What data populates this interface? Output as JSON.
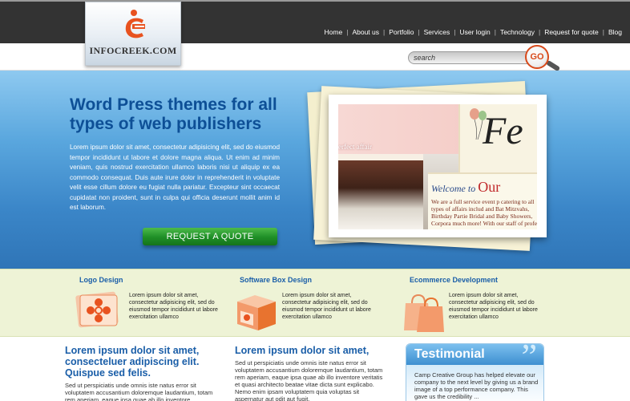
{
  "brand": {
    "name": "INFOCREEK.COM",
    "accent_color": "#e8521f"
  },
  "nav": {
    "items": [
      "Home",
      "About us",
      "Portfolio",
      "Services",
      "User login",
      "Technology",
      "Request for quote",
      "Blog"
    ]
  },
  "search": {
    "placeholder": "search",
    "button_label": "GO"
  },
  "hero": {
    "title": "Word Press themes for all types of web publishers",
    "body": "Lorem ipsum dolor sit amet, consectetur adipisicing elit, sed do eiusmod tempor incididunt ut labore et dolore magna aliqua. Ut enim ad minim veniam, quis nostrud exercitation ullamco laboris nisi ut aliquip ex ea commodo consequat. Duis aute irure dolor in reprehenderit in voluptate velit esse cillum dolore eu fugiat nulla pariatur. Excepteur sint occaecat cupidatat non proident, sunt in culpa qui officia deserunt mollit anim id est laborum.",
    "cta_label": "REQUEST A QUOTE",
    "photo": {
      "caption": "erfect affair",
      "welcome_text": "Welcome to",
      "welcome_big": "Our",
      "script_letter": "Fe",
      "paragraph": "We are a full service event p catering to all types of affairs includ and Bat Mitzvahs, Birthday Partie Bridal and Baby Showers, Corpora much more!  With our staff of profe"
    }
  },
  "services": [
    {
      "title": "Logo Design",
      "text": "Lorem ipsum dolor sit amet, consectetur adipisicing elit, sed do eiusmod tempor incididunt ut labore exercitation ullamco",
      "icon": "logo-design-icon"
    },
    {
      "title": "Software Box Design",
      "text": "Lorem ipsum dolor sit amet, consectetur adipisicing elit, sed do eiusmod tempor incididunt ut labore exercitation ullamco",
      "icon": "software-box-icon"
    },
    {
      "title": "Ecommerce Development",
      "text": "Lorem ipsum dolor sit amet, consectetur adipisicing elit, sed do eiusmod tempor incididunt ut labore exercitation ullamco",
      "icon": "shopping-bags-icon"
    }
  ],
  "content": {
    "col1_title": "Lorem ipsum dolor sit amet, consecteluer adipiscing elit. Quispue sed felis.",
    "col1_text": "Sed ut perspiciatis unde omnis iste natus error sit voluptatem accusantium doloremque laudantium, totam rem aperiam, eaque ipsa quae ab illo inventore",
    "col2_title": "Lorem ipsum dolor sit amet,",
    "col2_text": "Sed ut perspiciatis unde omnis iste natus error sit voluptatem accusantium doloremque laudantium, totam rem aperiam, eaque ipsa quae ab illo inventore veritatis et quasi architecto beatae vitae dicta sunt explicabo. Nemo enim ipsam voluptatem quia voluptas sit aspernatur aut odit aut fugit,",
    "testimonial_title": "Testimonial",
    "testimonial_text": "Camp Creative Group has helped elevate our company to the next level by giving us a brand image of a top performance company. This gave us the credibility ..."
  }
}
